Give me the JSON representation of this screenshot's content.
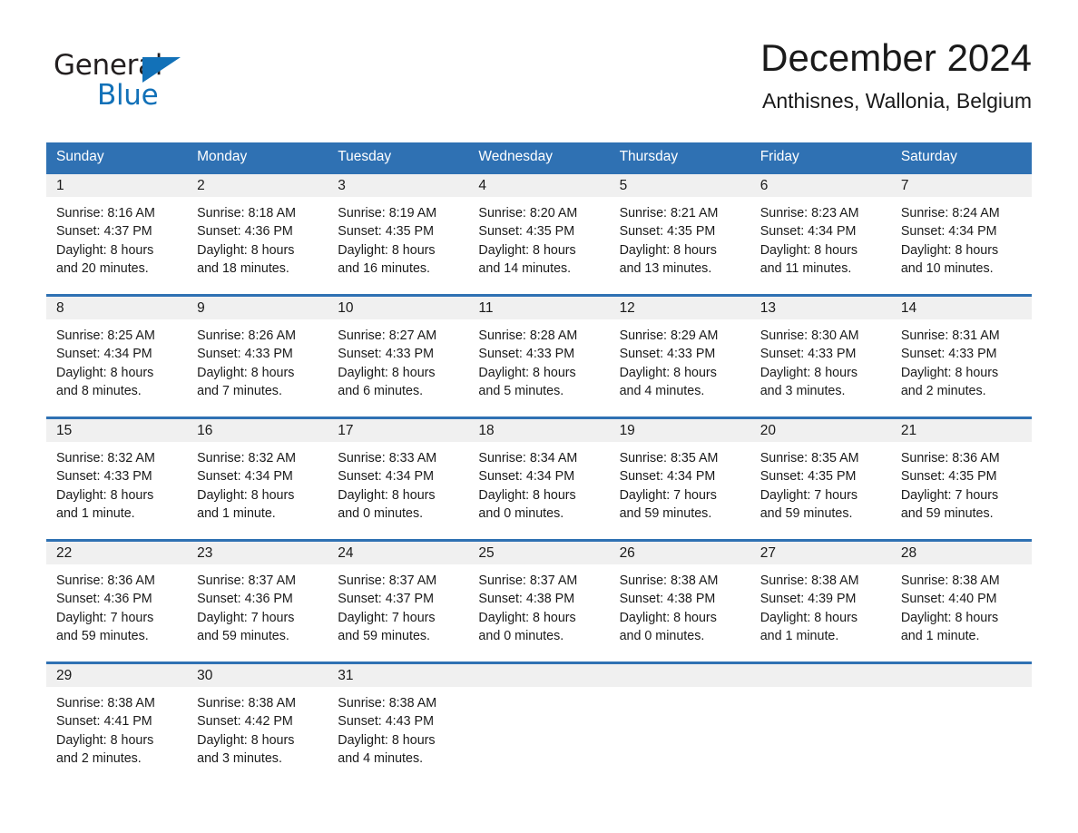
{
  "brand": {
    "name_part1": "General",
    "name_part2": "Blue",
    "accent_color": "#1271b8"
  },
  "header": {
    "month_title": "December 2024",
    "location": "Anthisnes, Wallonia, Belgium"
  },
  "calendar": {
    "header_color": "#2f71b3",
    "day_band_color": "#f0f0f0",
    "weekdays": [
      "Sunday",
      "Monday",
      "Tuesday",
      "Wednesday",
      "Thursday",
      "Friday",
      "Saturday"
    ],
    "weeks": [
      [
        {
          "day": "1",
          "sunrise": "Sunrise: 8:16 AM",
          "sunset": "Sunset: 4:37 PM",
          "daylight1": "Daylight: 8 hours",
          "daylight2": "and 20 minutes."
        },
        {
          "day": "2",
          "sunrise": "Sunrise: 8:18 AM",
          "sunset": "Sunset: 4:36 PM",
          "daylight1": "Daylight: 8 hours",
          "daylight2": "and 18 minutes."
        },
        {
          "day": "3",
          "sunrise": "Sunrise: 8:19 AM",
          "sunset": "Sunset: 4:35 PM",
          "daylight1": "Daylight: 8 hours",
          "daylight2": "and 16 minutes."
        },
        {
          "day": "4",
          "sunrise": "Sunrise: 8:20 AM",
          "sunset": "Sunset: 4:35 PM",
          "daylight1": "Daylight: 8 hours",
          "daylight2": "and 14 minutes."
        },
        {
          "day": "5",
          "sunrise": "Sunrise: 8:21 AM",
          "sunset": "Sunset: 4:35 PM",
          "daylight1": "Daylight: 8 hours",
          "daylight2": "and 13 minutes."
        },
        {
          "day": "6",
          "sunrise": "Sunrise: 8:23 AM",
          "sunset": "Sunset: 4:34 PM",
          "daylight1": "Daylight: 8 hours",
          "daylight2": "and 11 minutes."
        },
        {
          "day": "7",
          "sunrise": "Sunrise: 8:24 AM",
          "sunset": "Sunset: 4:34 PM",
          "daylight1": "Daylight: 8 hours",
          "daylight2": "and 10 minutes."
        }
      ],
      [
        {
          "day": "8",
          "sunrise": "Sunrise: 8:25 AM",
          "sunset": "Sunset: 4:34 PM",
          "daylight1": "Daylight: 8 hours",
          "daylight2": "and 8 minutes."
        },
        {
          "day": "9",
          "sunrise": "Sunrise: 8:26 AM",
          "sunset": "Sunset: 4:33 PM",
          "daylight1": "Daylight: 8 hours",
          "daylight2": "and 7 minutes."
        },
        {
          "day": "10",
          "sunrise": "Sunrise: 8:27 AM",
          "sunset": "Sunset: 4:33 PM",
          "daylight1": "Daylight: 8 hours",
          "daylight2": "and 6 minutes."
        },
        {
          "day": "11",
          "sunrise": "Sunrise: 8:28 AM",
          "sunset": "Sunset: 4:33 PM",
          "daylight1": "Daylight: 8 hours",
          "daylight2": "and 5 minutes."
        },
        {
          "day": "12",
          "sunrise": "Sunrise: 8:29 AM",
          "sunset": "Sunset: 4:33 PM",
          "daylight1": "Daylight: 8 hours",
          "daylight2": "and 4 minutes."
        },
        {
          "day": "13",
          "sunrise": "Sunrise: 8:30 AM",
          "sunset": "Sunset: 4:33 PM",
          "daylight1": "Daylight: 8 hours",
          "daylight2": "and 3 minutes."
        },
        {
          "day": "14",
          "sunrise": "Sunrise: 8:31 AM",
          "sunset": "Sunset: 4:33 PM",
          "daylight1": "Daylight: 8 hours",
          "daylight2": "and 2 minutes."
        }
      ],
      [
        {
          "day": "15",
          "sunrise": "Sunrise: 8:32 AM",
          "sunset": "Sunset: 4:33 PM",
          "daylight1": "Daylight: 8 hours",
          "daylight2": "and 1 minute."
        },
        {
          "day": "16",
          "sunrise": "Sunrise: 8:32 AM",
          "sunset": "Sunset: 4:34 PM",
          "daylight1": "Daylight: 8 hours",
          "daylight2": "and 1 minute."
        },
        {
          "day": "17",
          "sunrise": "Sunrise: 8:33 AM",
          "sunset": "Sunset: 4:34 PM",
          "daylight1": "Daylight: 8 hours",
          "daylight2": "and 0 minutes."
        },
        {
          "day": "18",
          "sunrise": "Sunrise: 8:34 AM",
          "sunset": "Sunset: 4:34 PM",
          "daylight1": "Daylight: 8 hours",
          "daylight2": "and 0 minutes."
        },
        {
          "day": "19",
          "sunrise": "Sunrise: 8:35 AM",
          "sunset": "Sunset: 4:34 PM",
          "daylight1": "Daylight: 7 hours",
          "daylight2": "and 59 minutes."
        },
        {
          "day": "20",
          "sunrise": "Sunrise: 8:35 AM",
          "sunset": "Sunset: 4:35 PM",
          "daylight1": "Daylight: 7 hours",
          "daylight2": "and 59 minutes."
        },
        {
          "day": "21",
          "sunrise": "Sunrise: 8:36 AM",
          "sunset": "Sunset: 4:35 PM",
          "daylight1": "Daylight: 7 hours",
          "daylight2": "and 59 minutes."
        }
      ],
      [
        {
          "day": "22",
          "sunrise": "Sunrise: 8:36 AM",
          "sunset": "Sunset: 4:36 PM",
          "daylight1": "Daylight: 7 hours",
          "daylight2": "and 59 minutes."
        },
        {
          "day": "23",
          "sunrise": "Sunrise: 8:37 AM",
          "sunset": "Sunset: 4:36 PM",
          "daylight1": "Daylight: 7 hours",
          "daylight2": "and 59 minutes."
        },
        {
          "day": "24",
          "sunrise": "Sunrise: 8:37 AM",
          "sunset": "Sunset: 4:37 PM",
          "daylight1": "Daylight: 7 hours",
          "daylight2": "and 59 minutes."
        },
        {
          "day": "25",
          "sunrise": "Sunrise: 8:37 AM",
          "sunset": "Sunset: 4:38 PM",
          "daylight1": "Daylight: 8 hours",
          "daylight2": "and 0 minutes."
        },
        {
          "day": "26",
          "sunrise": "Sunrise: 8:38 AM",
          "sunset": "Sunset: 4:38 PM",
          "daylight1": "Daylight: 8 hours",
          "daylight2": "and 0 minutes."
        },
        {
          "day": "27",
          "sunrise": "Sunrise: 8:38 AM",
          "sunset": "Sunset: 4:39 PM",
          "daylight1": "Daylight: 8 hours",
          "daylight2": "and 1 minute."
        },
        {
          "day": "28",
          "sunrise": "Sunrise: 8:38 AM",
          "sunset": "Sunset: 4:40 PM",
          "daylight1": "Daylight: 8 hours",
          "daylight2": "and 1 minute."
        }
      ],
      [
        {
          "day": "29",
          "sunrise": "Sunrise: 8:38 AM",
          "sunset": "Sunset: 4:41 PM",
          "daylight1": "Daylight: 8 hours",
          "daylight2": "and 2 minutes."
        },
        {
          "day": "30",
          "sunrise": "Sunrise: 8:38 AM",
          "sunset": "Sunset: 4:42 PM",
          "daylight1": "Daylight: 8 hours",
          "daylight2": "and 3 minutes."
        },
        {
          "day": "31",
          "sunrise": "Sunrise: 8:38 AM",
          "sunset": "Sunset: 4:43 PM",
          "daylight1": "Daylight: 8 hours",
          "daylight2": "and 4 minutes."
        },
        {
          "day": "",
          "sunrise": "",
          "sunset": "",
          "daylight1": "",
          "daylight2": ""
        },
        {
          "day": "",
          "sunrise": "",
          "sunset": "",
          "daylight1": "",
          "daylight2": ""
        },
        {
          "day": "",
          "sunrise": "",
          "sunset": "",
          "daylight1": "",
          "daylight2": ""
        },
        {
          "day": "",
          "sunrise": "",
          "sunset": "",
          "daylight1": "",
          "daylight2": ""
        }
      ]
    ]
  }
}
